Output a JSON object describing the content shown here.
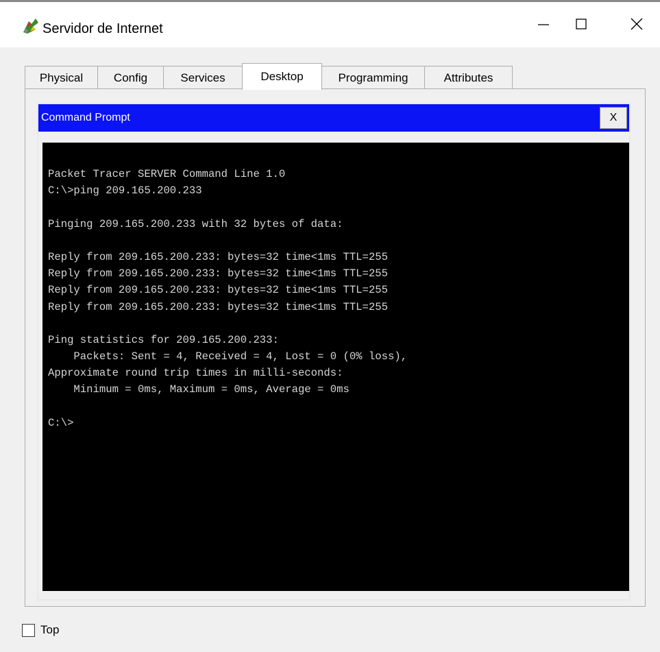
{
  "window": {
    "title": "Servidor de Internet",
    "icon": "packet-tracer-server-icon",
    "controls": [
      "minimize-icon",
      "maximize-icon",
      "close-icon"
    ]
  },
  "tabs": [
    {
      "label": "Physical",
      "active": false
    },
    {
      "label": "Config",
      "active": false
    },
    {
      "label": "Services",
      "active": false
    },
    {
      "label": "Desktop",
      "active": true
    },
    {
      "label": "Programming",
      "active": false
    },
    {
      "label": "Attributes",
      "active": false
    }
  ],
  "command_prompt": {
    "title": "Command Prompt",
    "close_label": "X",
    "header_color": "#0a14f5",
    "lines": [
      "Packet Tracer SERVER Command Line 1.0",
      "C:\\>ping 209.165.200.233",
      "",
      "Pinging 209.165.200.233 with 32 bytes of data:",
      "",
      "Reply from 209.165.200.233: bytes=32 time<1ms TTL=255",
      "Reply from 209.165.200.233: bytes=32 time<1ms TTL=255",
      "Reply from 209.165.200.233: bytes=32 time<1ms TTL=255",
      "Reply from 209.165.200.233: bytes=32 time<1ms TTL=255",
      "",
      "Ping statistics for 209.165.200.233:",
      "    Packets: Sent = 4, Received = 4, Lost = 0 (0% loss),",
      "Approximate round trip times in milli-seconds:",
      "    Minimum = 0ms, Maximum = 0ms, Average = 0ms",
      "",
      "C:\\>"
    ]
  },
  "bottom": {
    "top_checkbox_label": "Top",
    "top_checked": false
  }
}
